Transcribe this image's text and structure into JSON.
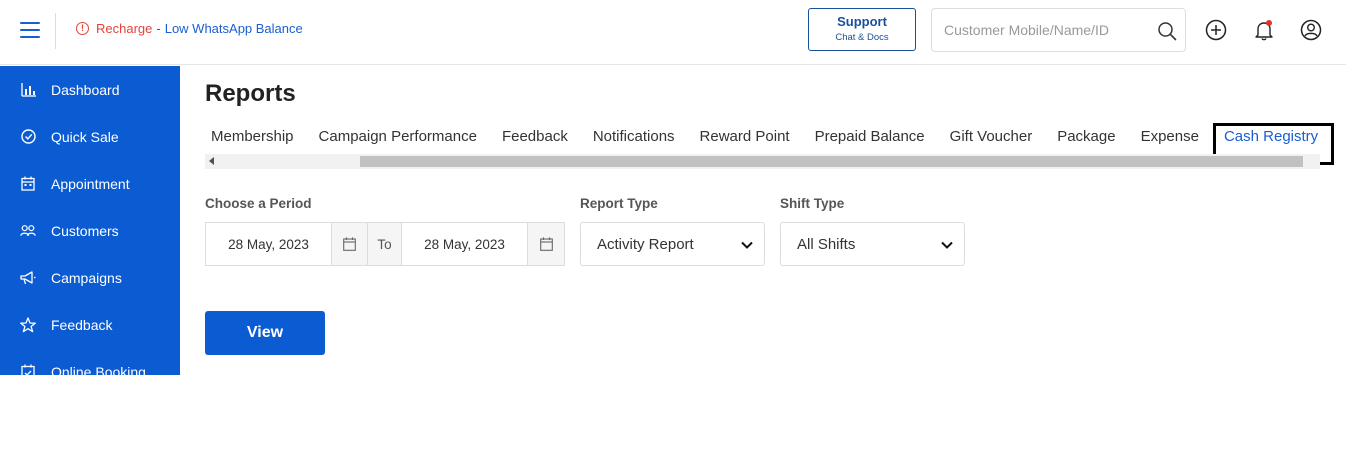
{
  "header": {
    "alert_prefix": "Recharge",
    "alert_separator": "-",
    "alert_text": "Low WhatsApp Balance",
    "support_label": "Support",
    "support_sub": "Chat & Docs",
    "search_placeholder": "Customer Mobile/Name/ID"
  },
  "sidebar": {
    "items": [
      {
        "label": "Dashboard",
        "icon": "bar-chart-icon"
      },
      {
        "label": "Quick Sale",
        "icon": "check-circle-icon"
      },
      {
        "label": "Appointment",
        "icon": "calendar-icon"
      },
      {
        "label": "Customers",
        "icon": "users-icon"
      },
      {
        "label": "Campaigns",
        "icon": "megaphone-icon"
      },
      {
        "label": "Feedback",
        "icon": "star-icon"
      },
      {
        "label": "Online Booking",
        "icon": "calendar-check-icon"
      }
    ]
  },
  "main": {
    "title": "Reports",
    "tabs": [
      "Membership",
      "Campaign Performance",
      "Feedback",
      "Notifications",
      "Reward Point",
      "Prepaid Balance",
      "Gift Voucher",
      "Package",
      "Expense",
      "Cash Registry"
    ],
    "active_tab": "Cash Registry",
    "period_label": "Choose a Period",
    "date_from": "28 May, 2023",
    "to_label": "To",
    "date_to": "28 May, 2023",
    "report_type_label": "Report Type",
    "report_type_value": "Activity Report",
    "shift_type_label": "Shift Type",
    "shift_type_value": "All Shifts",
    "view_label": "View"
  },
  "colors": {
    "primary": "#0b5bd3",
    "alert_red": "#e0453b",
    "link_blue": "#1a5fd0"
  }
}
